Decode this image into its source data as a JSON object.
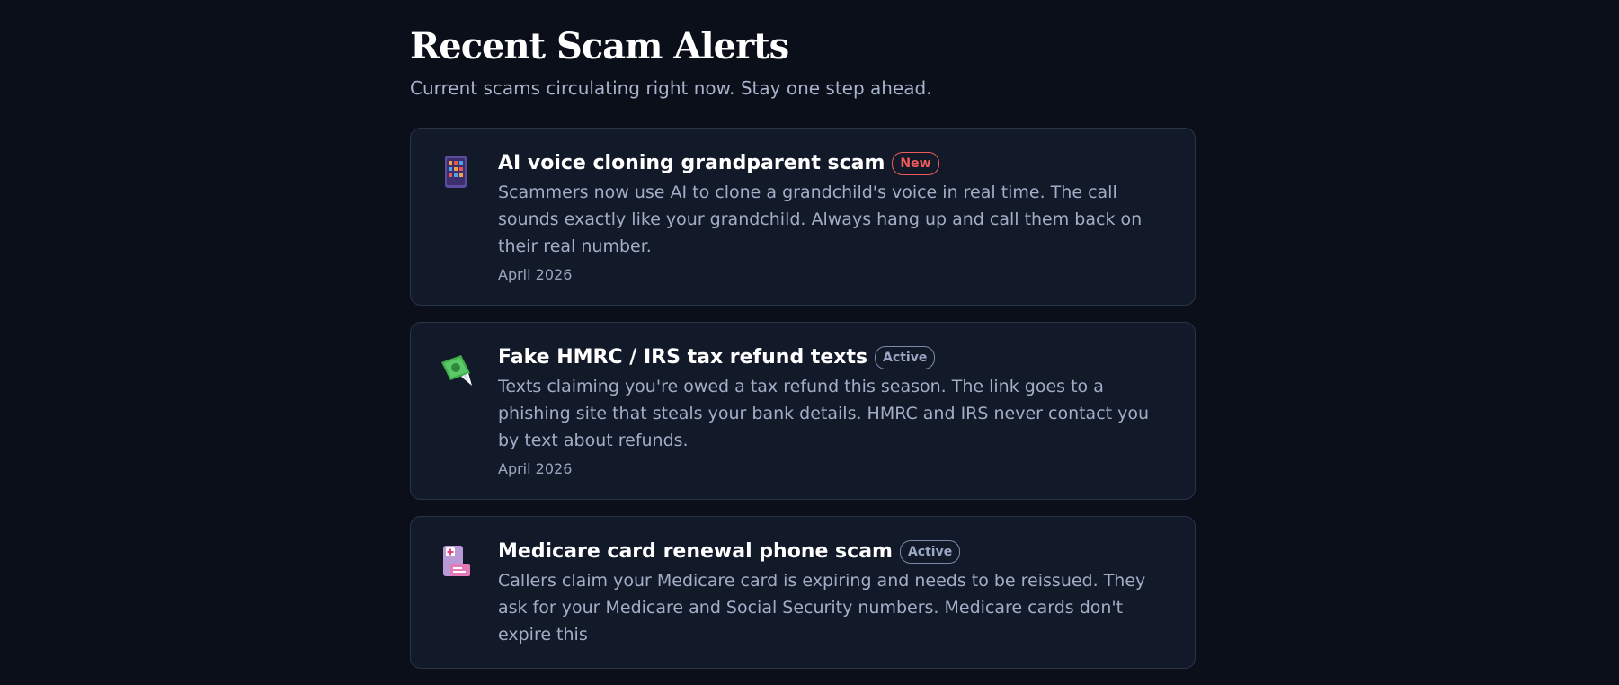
{
  "header": {
    "title": "Recent Scam Alerts",
    "subtitle": "Current scams circulating right now. Stay one step ahead."
  },
  "alerts": [
    {
      "icon": "phone-icon",
      "title": "AI voice cloning grandparent scam",
      "badge": "New",
      "badge_color": "#ef5a5a",
      "description": "Scammers now use AI to clone a grandchild's voice in real time. The call sounds exactly like your grandchild. Always hang up and call them back on their real number.",
      "date": "April 2026"
    },
    {
      "icon": "money-with-wings-icon",
      "title": "Fake HMRC / IRS tax refund texts",
      "badge": "Active",
      "badge_color": "#9aa7c4",
      "description": "Texts claiming you're owed a tax refund this season. The link goes to a phishing site that steals your bank details. HMRC and IRS never contact you by text about refunds.",
      "date": "April 2026"
    },
    {
      "icon": "medical-card-icon",
      "title": "Medicare card renewal phone scam",
      "badge": "Active",
      "badge_color": "#9aa7c4",
      "description": "Callers claim your Medicare card is expiring and needs to be reissued. They ask for your Medicare and Social Security numbers. Medicare cards don't expire this",
      "date": ""
    }
  ]
}
